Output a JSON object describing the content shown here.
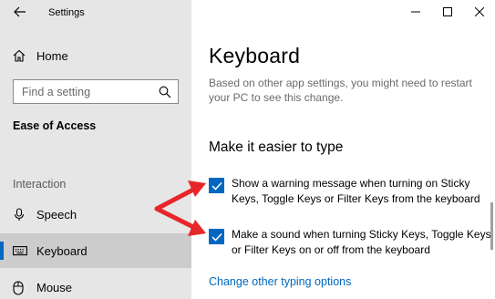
{
  "window": {
    "title": "Settings",
    "controls": [
      "minimize-icon",
      "maximize-icon",
      "close-icon"
    ]
  },
  "sidebar": {
    "back_icon": "back-arrow-icon",
    "home_label": "Home",
    "search_placeholder": "Find a setting",
    "section_title": "Ease of Access",
    "group_label": "Interaction",
    "items": [
      {
        "label": "Speech",
        "icon": "microphone-icon",
        "selected": false
      },
      {
        "label": "Keyboard",
        "icon": "keyboard-icon",
        "selected": true
      },
      {
        "label": "Mouse",
        "icon": "mouse-icon",
        "selected": false
      }
    ]
  },
  "main": {
    "title": "Keyboard",
    "info": "Based on other app settings, you might need to restart your PC to see this change.",
    "subheading": "Make it easier to type",
    "options": [
      {
        "label": "Show a warning message when turning on Sticky Keys, Toggle Keys or Filter Keys from the keyboard",
        "checked": true
      },
      {
        "label": "Make a sound when turning Sticky Keys, Toggle Keys or Filter Keys on or off from the keyboard",
        "checked": true
      }
    ],
    "link": "Change other typing options"
  },
  "colors": {
    "accent": "#0067c0",
    "sidebar_bg": "#e6e6e6",
    "selected_bg": "#cccccc",
    "annotation_arrow": "#e8262a"
  }
}
